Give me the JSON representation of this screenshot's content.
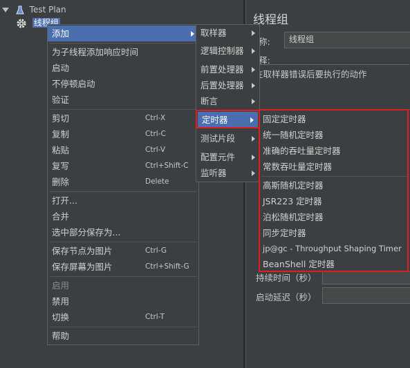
{
  "tree": {
    "root_label": "Test Plan",
    "selected_label": "线程组"
  },
  "context_menu": {
    "items": [
      {
        "label": "添加",
        "has_submenu": true,
        "highlighted": true
      },
      {
        "label": "为子线程添加响应时间"
      },
      {
        "label": "启动"
      },
      {
        "label": "不停顿启动"
      },
      {
        "label": "验证"
      },
      {
        "label": "剪切",
        "shortcut": "Ctrl-X"
      },
      {
        "label": "复制",
        "shortcut": "Ctrl-C"
      },
      {
        "label": "粘贴",
        "shortcut": "Ctrl-V"
      },
      {
        "label": "复写",
        "shortcut": "Ctrl+Shift-C"
      },
      {
        "label": "删除",
        "shortcut": "Delete"
      },
      {
        "label": "打开..."
      },
      {
        "label": "合并"
      },
      {
        "label": "选中部分保存为..."
      },
      {
        "label": "保存节点为图片",
        "shortcut": "Ctrl-G"
      },
      {
        "label": "保存屏幕为图片",
        "shortcut": "Ctrl+Shift-G"
      },
      {
        "label": "启用",
        "disabled": true
      },
      {
        "label": "禁用"
      },
      {
        "label": "切换",
        "shortcut": "Ctrl-T"
      },
      {
        "label": "帮助"
      }
    ]
  },
  "add_submenu": {
    "items": [
      {
        "label": "取样器"
      },
      {
        "label": "逻辑控制器"
      },
      {
        "label": "前置处理器"
      },
      {
        "label": "后置处理器"
      },
      {
        "label": "断言"
      },
      {
        "label": "定时器",
        "highlighted": true
      },
      {
        "label": "测试片段"
      },
      {
        "label": "配置元件"
      },
      {
        "label": "监听器"
      }
    ]
  },
  "timer_submenu": {
    "items": [
      {
        "label": "固定定时器"
      },
      {
        "label": "统一随机定时器"
      },
      {
        "label": "准确的吞吐量定时器"
      },
      {
        "label": "常数吞吐量定时器"
      },
      {
        "label": "高斯随机定时器"
      },
      {
        "label": "JSR223 定时器"
      },
      {
        "label": "泊松随机定时器"
      },
      {
        "label": "同步定时器"
      },
      {
        "label": "jp@gc - Throughput Shaping Timer"
      },
      {
        "label": "BeanShell 定时器"
      }
    ]
  },
  "right_panel": {
    "title": "线程组",
    "name_label": "称:",
    "name_value": "线程组",
    "comment_label": "释:",
    "error_action_label": "在取样器错误后要执行的动作",
    "duration_label": "持续时间（秒）",
    "startup_delay_label": "启动延迟（秒）"
  },
  "colors": {
    "background": "#3c3f41",
    "highlight": "#4b6eaf",
    "annotation_red": "#e02020"
  }
}
